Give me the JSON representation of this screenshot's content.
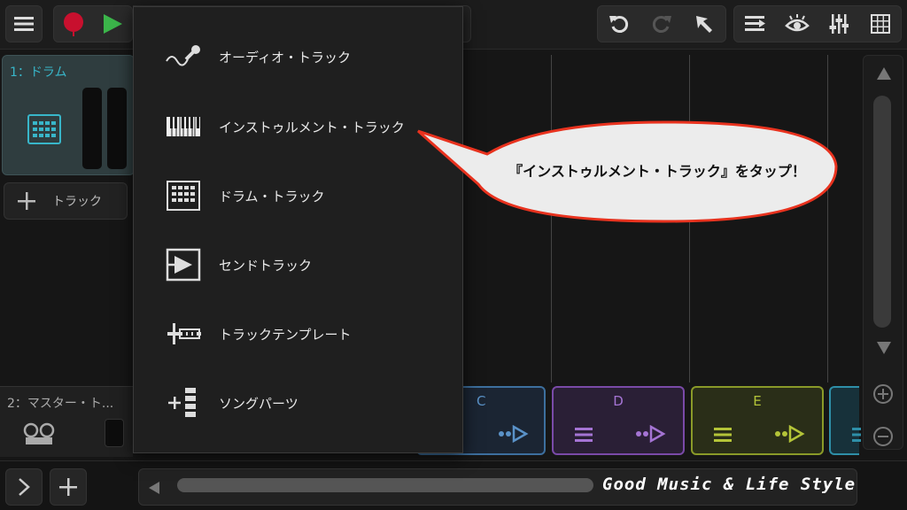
{
  "tracks": {
    "track1_name": "1：ドラム",
    "add_track_label": "トラック",
    "master_name": "2：マスター・ト..."
  },
  "clips": [
    {
      "label": "C",
      "color": "#3d6f9e"
    },
    {
      "label": "D",
      "color": "#7a4aa8"
    },
    {
      "label": "E",
      "color": "#8a9a28"
    }
  ],
  "menu": {
    "items": [
      {
        "label": "オーディオ・トラック",
        "icon": "microphone-icon"
      },
      {
        "label": "インストゥルメント・トラック",
        "icon": "piano-keyboard-icon"
      },
      {
        "label": "ドラム・トラック",
        "icon": "drum-pad-icon"
      },
      {
        "label": "センドトラック",
        "icon": "send-track-icon"
      },
      {
        "label": "トラックテンプレート",
        "icon": "track-template-icon"
      },
      {
        "label": "ソングパーツ",
        "icon": "song-parts-icon"
      }
    ]
  },
  "callout": {
    "text": "『インストゥルメント・トラック』をタップ！"
  },
  "watermark": "Good Music & Life Style",
  "colors": {
    "record": "#c8102e",
    "play": "#3bb54a",
    "track_accent": "#38b6c9",
    "callout_border": "#e8321e"
  }
}
